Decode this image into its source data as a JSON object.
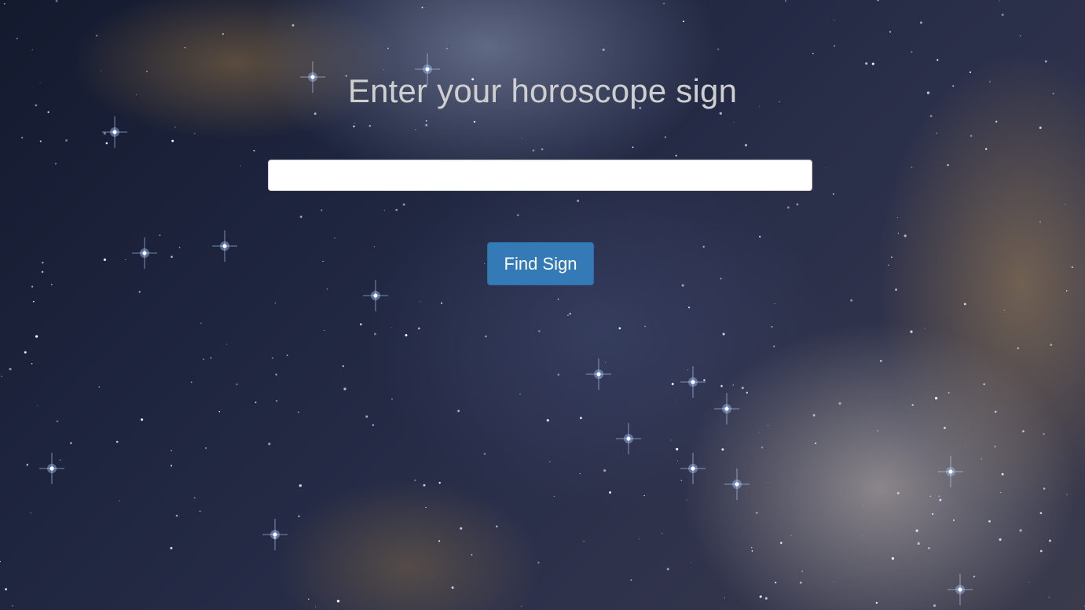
{
  "page": {
    "heading": "Enter your horoscope sign"
  },
  "search": {
    "value": "",
    "placeholder": ""
  },
  "actions": {
    "find_label": "Find Sign"
  },
  "theme": {
    "background": "space-nebula-starfield",
    "button_color": "#337ab7",
    "heading_color": "#cfcfcf"
  }
}
